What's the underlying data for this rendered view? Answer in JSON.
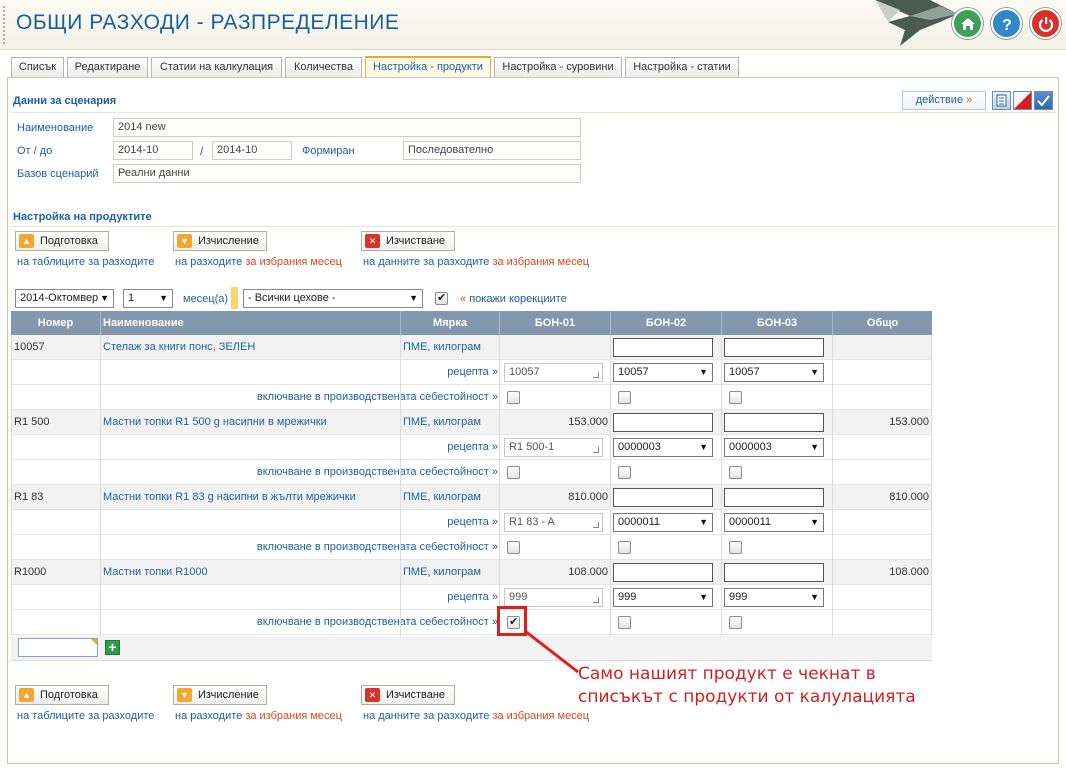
{
  "app": {
    "title": "ОБЩИ РАЗХОДИ - РАЗПРЕДЕЛЕНИЕ"
  },
  "header_buttons": [
    {
      "icon": "home-icon",
      "color": "#3f9e59"
    },
    {
      "icon": "help-icon",
      "color": "#2f86c9"
    },
    {
      "icon": "power-icon",
      "color": "#d8302a"
    }
  ],
  "tabs": [
    {
      "label": "Списък"
    },
    {
      "label": "Редактиране"
    },
    {
      "label": "Статии на калкулация"
    },
    {
      "label": "Количества"
    },
    {
      "label": "Настройка - продукти",
      "active": true
    },
    {
      "label": "Настройка - суровини"
    },
    {
      "label": "Настройка - статии"
    }
  ],
  "scenario": {
    "section_title": "Данни за сценария",
    "action_label": "действие",
    "action_arrow": "»",
    "name_label": "Наименование",
    "name_value": "2014 new",
    "period_label": "От / до",
    "from_value": "2014-10",
    "period_sep": "/",
    "to_value": "2014-10",
    "formed_label": "Формиран",
    "formed_value": "Последователно",
    "base_label": "Базов сценарий",
    "base_value": "Реални данни"
  },
  "products": {
    "section_title": "Настройка на продуктите",
    "buttons": {
      "prepare": "Подготовка",
      "calculate": "Изчисление",
      "clear": "Изчистване"
    },
    "links": {
      "prepare": "на таблиците за разходите",
      "calc_a": "на разходите ",
      "calc_b": "за избрания месец",
      "clear_a": "на данните за разходите ",
      "clear_b": "за избрания месец"
    },
    "filter": {
      "month_value": "2014-Октомвер",
      "count_value": "1",
      "months_label": "месец(а)",
      "workshop_value": "- Всички цехове -",
      "show_corrections_prefix": "«",
      "show_corrections_label": "покажи корекциите"
    }
  },
  "table": {
    "headers": [
      "Номер",
      "Наименование",
      "Мярка",
      "БОН-01",
      "БОН-02",
      "БОН-03",
      "Общо"
    ],
    "recipe_label": "рецепта",
    "include_label": "включване в производствената себестойност",
    "link_arrow": "»",
    "products": [
      {
        "number": "10057",
        "name": "Стелаж за книги понс, ЗЕЛЕН",
        "unit": "ПМЕ, килограм",
        "bon01": "",
        "total": "",
        "recipes": [
          "10057",
          "10057",
          "10057"
        ],
        "include": [
          false,
          false,
          false
        ]
      },
      {
        "number": "R1 500",
        "name": "Мастни топки R1 500 g насипни в мрежички",
        "unit": "ПМЕ, килограм",
        "bon01": "153.000",
        "total": "153.000",
        "recipes": [
          "R1 500-1",
          "0000003",
          "0000003"
        ],
        "include": [
          false,
          false,
          false
        ]
      },
      {
        "number": "R1 83",
        "name": "Мастни топки R1 83 g насипни в жълти мрежички",
        "unit": "ПМЕ, килограм",
        "bon01": "810.000",
        "total": "810.000",
        "recipes": [
          "R1 83 - A",
          "0000011",
          "0000011"
        ],
        "include": [
          false,
          false,
          false
        ]
      },
      {
        "number": "R1000",
        "name": "Мастни топки R1000",
        "unit": "ПМЕ, килограм",
        "bon01": "108.000",
        "total": "108.000",
        "recipes": [
          "999",
          "999",
          "999"
        ],
        "include": [
          true,
          false,
          false
        ]
      }
    ]
  },
  "annotation": {
    "line1": "Само нашият продукт е чекнат в",
    "line2": "списъкът с продукти от калулацията",
    "color": "#d71e1e"
  }
}
